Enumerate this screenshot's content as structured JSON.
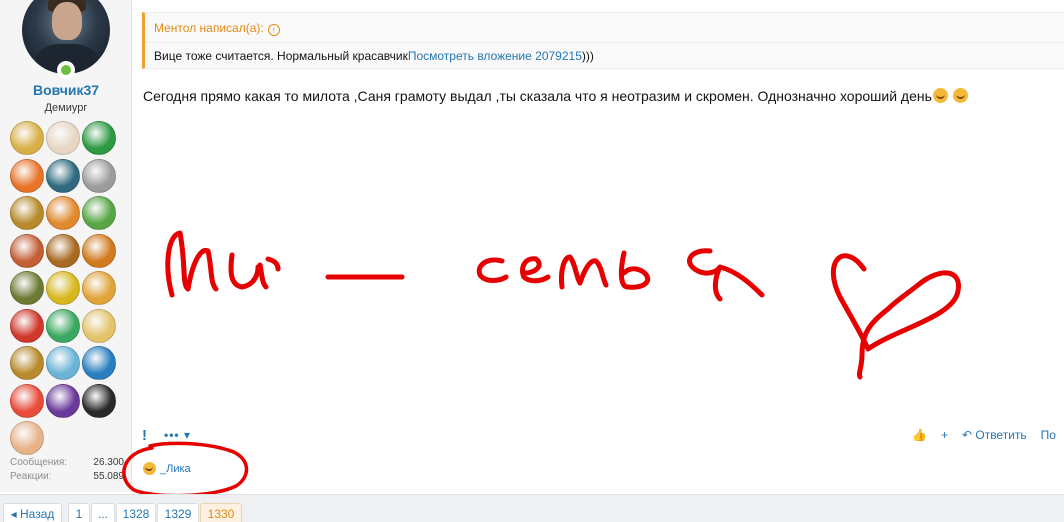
{
  "user": {
    "name": "Вовчик37",
    "title": "Демиург",
    "trophies": [
      {
        "icon": "laurel-icon",
        "color": "#d9b048"
      },
      {
        "icon": "snowman-icon",
        "color": "#e7d7c2"
      },
      {
        "icon": "medical-bag-icon",
        "color": "#2e9a44"
      },
      {
        "icon": "people-circle-icon",
        "color": "#e8742a"
      },
      {
        "icon": "bearded-man-icon",
        "color": "#2f6a80"
      },
      {
        "icon": "knight-icon",
        "color": "#9c9c9c"
      },
      {
        "icon": "gold-star-medal-icon",
        "color": "#b88a2c"
      },
      {
        "icon": "tiger-icon",
        "color": "#e0892f"
      },
      {
        "icon": "map-icon",
        "color": "#58a646"
      },
      {
        "icon": "suitcase-2-icon",
        "color": "#c25f35"
      },
      {
        "icon": "treasure-chest-icon",
        "color": "#a86a22"
      },
      {
        "icon": "pirate-ship-icon",
        "color": "#d27a1e"
      },
      {
        "icon": "soldier-icon",
        "color": "#6d7a34"
      },
      {
        "icon": "detective-icon",
        "color": "#d8b71e"
      },
      {
        "icon": "camel-icon",
        "color": "#e2a43a"
      },
      {
        "icon": "theatre-masks-icon",
        "color": "#d0382c"
      },
      {
        "icon": "emerald-city-icon",
        "color": "#3aa860"
      },
      {
        "icon": "horseshoe-icon",
        "color": "#e3c46b"
      },
      {
        "icon": "gold-star-medal-icon",
        "color": "#b88a2c"
      },
      {
        "icon": "landscape-icon",
        "color": "#6bb4d8"
      },
      {
        "icon": "anniversary-90-icon",
        "color": "#2a7fc0"
      },
      {
        "icon": "candy-badge-icon",
        "color": "#e84c3a"
      },
      {
        "icon": "eye-circle-icon",
        "color": "#6a3a9a"
      },
      {
        "icon": "gentleman-icon",
        "color": "#2a2a2a"
      },
      {
        "icon": "flower-icon",
        "color": "#e7b48a"
      }
    ],
    "stats": [
      {
        "label": "Сообщения:",
        "value": "26.300"
      },
      {
        "label": "Реакции:",
        "value": "55.089"
      }
    ]
  },
  "quote": {
    "author": "Ментол написал(а):",
    "text": "Вице тоже считается. Нормальный красавчик",
    "link": "Посмотреть вложение 2079215",
    "tail": ")))"
  },
  "message": {
    "text": "Сегодня прямо какая то милота ,Саня грамоту выдал ,ты сказала что я неотразим и скромен. Однозначно хороший день"
  },
  "actions": {
    "more": "•••",
    "reply": "Ответить",
    "cut": "По"
  },
  "reactions": {
    "user": "_Лика"
  },
  "pagination": {
    "prev": "◂ Назад",
    "pages": [
      "1",
      "...",
      "1328",
      "1329",
      "1330"
    ],
    "current": "1330"
  },
  "colors": {
    "accent": "#2577b1",
    "quote": "#e38a14",
    "ink": "#e60000"
  }
}
